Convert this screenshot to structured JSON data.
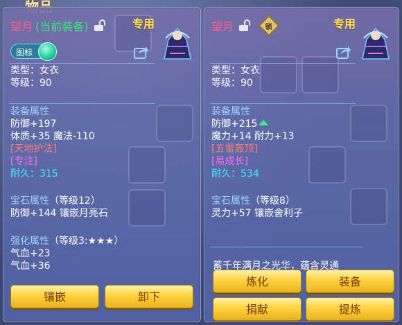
{
  "background": {
    "title": "物品"
  },
  "left_panel": {
    "name": "望月",
    "equipped_tag": "(当前装备)",
    "exclusive": "专用",
    "icon_toggle_label": "图标",
    "type_line": "类型：女衣",
    "level_line": "等级：90",
    "attr_header": "装备属性",
    "attr_lines": [
      "防御+197",
      "体质+35 魔法-110"
    ],
    "special_1": "[天地护法]",
    "special_2": "[专注]",
    "durability_label": "耐久：",
    "durability_value": "315",
    "gem_header": "宝石属性",
    "gem_level": "（等级12）",
    "gem_line": "防御+144 镶嵌月亮石",
    "enhance_header": "强化属性",
    "enhance_level": "（等级3:★★★）",
    "enhance_lines": [
      "气血+23",
      "气血+36"
    ],
    "buttons": {
      "inlay": "镶嵌",
      "unequip": "卸下"
    }
  },
  "right_panel": {
    "name": "望月",
    "badge_text": "锁",
    "exclusive": "专用",
    "type_line": "类型：女衣",
    "level_line": "等级：90",
    "attr_header": "装备属性",
    "attr_line_1": "防御+215",
    "attr_line_2": "魔力+14 耐力+13",
    "special_1": "[五雷轰顶]",
    "special_2": "[易成长]",
    "durability_label": "耐久：",
    "durability_value": "534",
    "gem_header": "宝石属性",
    "gem_level": "（等级8）",
    "gem_line": "灵力+57 镶嵌舍利子",
    "description": "蓄千年满月之光华，蕴含灵通",
    "buttons": {
      "refine": "炼化",
      "equip": "装备",
      "donate": "捐献",
      "extract": "提炼"
    }
  },
  "colors": {
    "name": "#ff5b8e",
    "equipped": "#37e57b",
    "exclusive": "#ffe26a",
    "section_header": "#9fd2ff",
    "special_red": "#ff7a7a",
    "special_magenta": "#ff6ef5",
    "durability": "#47e9ff",
    "button": "#ffd23d"
  }
}
